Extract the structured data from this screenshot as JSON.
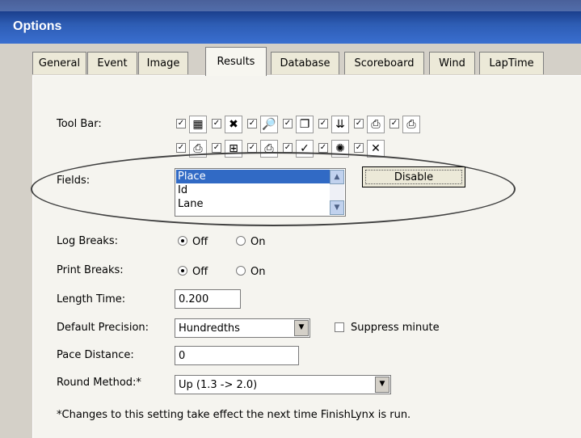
{
  "window": {
    "title": "Options"
  },
  "tabs": [
    {
      "label": "General"
    },
    {
      "label": "Event"
    },
    {
      "label": "Image"
    },
    {
      "label": "Results"
    },
    {
      "label": "Database"
    },
    {
      "label": "Scoreboard"
    },
    {
      "label": "Wind"
    },
    {
      "label": "LapTime"
    }
  ],
  "toolbar": {
    "label": "Tool Bar:",
    "items": [
      {
        "icon": "grid-icon",
        "checked": true
      },
      {
        "icon": "delete-icon",
        "checked": true
      },
      {
        "icon": "find-icon",
        "checked": true
      },
      {
        "icon": "windows-icon",
        "checked": true
      },
      {
        "icon": "arrows-down-icon",
        "checked": true
      },
      {
        "icon": "printer-export-icon",
        "checked": true
      },
      {
        "icon": "printer-color-icon",
        "checked": true
      },
      {
        "icon": "printer-arrow-icon",
        "checked": true
      },
      {
        "icon": "tree-icon",
        "checked": true
      },
      {
        "icon": "printer-icon",
        "checked": true
      },
      {
        "icon": "checkmark-icon",
        "checked": true
      },
      {
        "icon": "burst-icon",
        "checked": true
      },
      {
        "icon": "red-x-icon",
        "checked": true
      }
    ]
  },
  "fields": {
    "label": "Fields:",
    "items": [
      "Place",
      "Id",
      "Lane"
    ],
    "selected": "Place",
    "button": "Disable"
  },
  "log_breaks": {
    "label": "Log Breaks:",
    "options": [
      "Off",
      "On"
    ],
    "selected": "Off"
  },
  "print_breaks": {
    "label": "Print Breaks:",
    "options": [
      "Off",
      "On"
    ],
    "selected": "Off"
  },
  "length_time": {
    "label": "Length Time:",
    "value": "0.200"
  },
  "default_precision": {
    "label": "Default Precision:",
    "value": "Hundredths",
    "suppress_label": "Suppress minute",
    "suppress_checked": false
  },
  "pace_distance": {
    "label": "Pace Distance:",
    "value": "0"
  },
  "round_method": {
    "label": "Round Method:*",
    "value": "Up  (1.3 -> 2.0)"
  },
  "footnote": "*Changes to this setting take effect the next time FinishLynx is run."
}
